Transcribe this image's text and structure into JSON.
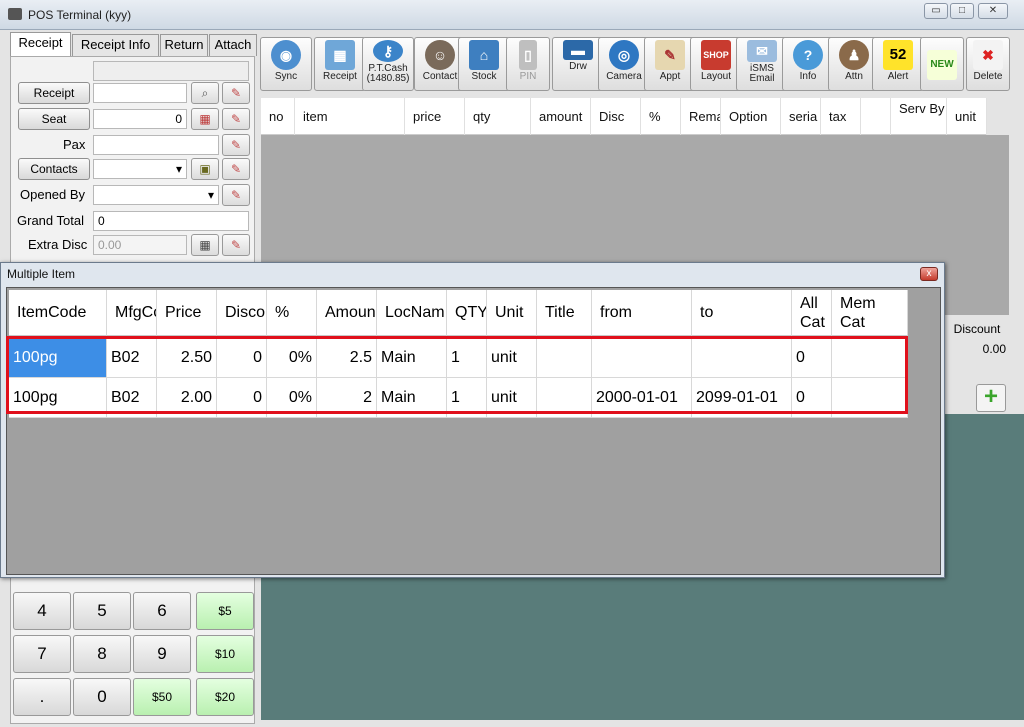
{
  "window": {
    "title": "POS Terminal (kyy)",
    "min": "▭",
    "restore": "□",
    "close": "✕"
  },
  "tabs": [
    "Receipt",
    "Receipt Info",
    "Return",
    "Attach"
  ],
  "left": {
    "receipt_btn": "Receipt",
    "seat_btn": "Seat",
    "seat_value": "0",
    "pax_label": "Pax",
    "contacts_btn": "Contacts",
    "opened_by_label": "Opened By",
    "grand_total_label": "Grand Total",
    "grand_total_value": "0",
    "extra_disc_label": "Extra Disc",
    "extra_disc_value": "0.00"
  },
  "keypad": {
    "keys": [
      "4",
      "5",
      "6",
      "7",
      "8",
      "9",
      ".",
      "0"
    ],
    "money": [
      "$5",
      "$10",
      "$50",
      "$20"
    ]
  },
  "toolbar": [
    {
      "label": "Sync",
      "icon": "sync-icon"
    },
    {
      "label": "Receipt",
      "icon": "receipt-icon"
    },
    {
      "label": "P.T.Cash\n(1480.85)",
      "icon": "key-icon"
    },
    {
      "label": "Contact",
      "icon": "contact-icon"
    },
    {
      "label": "Stock",
      "icon": "house-icon"
    },
    {
      "label": "PIN",
      "icon": "phone-icon"
    },
    {
      "label": "Drw",
      "icon": "drawer-icon"
    },
    {
      "label": "Camera",
      "icon": "camera-icon"
    },
    {
      "label": "Appt",
      "icon": "appointment-icon"
    },
    {
      "label": "Layout",
      "icon": "shop-icon"
    },
    {
      "label": "iSMS\nEmail",
      "icon": "email-icon"
    },
    {
      "label": "Info",
      "icon": "info-icon"
    },
    {
      "label": "Attn",
      "icon": "attendance-icon"
    },
    {
      "label": "Alert",
      "icon": "alert-icon",
      "badge": "52"
    },
    {
      "label": "NEW",
      "icon": "new-icon"
    },
    {
      "label": "Delete",
      "icon": "delete-icon"
    }
  ],
  "grid_headers": [
    "no",
    "item",
    "price",
    "qty",
    "amount",
    "Disc",
    "%",
    "Rema",
    "Option",
    "seria",
    "tax",
    "",
    "Serv By",
    "unit"
  ],
  "discount": {
    "label": "Discount",
    "value": "0.00"
  },
  "dialog": {
    "title": "Multiple Item",
    "close": "x",
    "headers": [
      "ItemCode",
      "MfgCo",
      "Price",
      "Disco",
      "%",
      "Amoun",
      "LocNam",
      "QTY",
      "Unit",
      "Title",
      "from",
      "to",
      "All\nCat",
      "Mem\nCat"
    ],
    "rows": [
      [
        "100pg",
        "B02",
        "2.50",
        "0",
        "0%",
        "2.5",
        "Main",
        "1",
        "unit",
        "",
        "",
        "",
        "0",
        ""
      ],
      [
        "100pg",
        "B02",
        "2.00",
        "0",
        "0%",
        "2",
        "Main",
        "1",
        "unit",
        "",
        "2000-01-01",
        "2099-01-01",
        "0",
        ""
      ]
    ]
  },
  "colors": {
    "selection": "#3d8ee6",
    "highlight_box": "#e0101c",
    "teal_panel": "#597c7a",
    "money_key": "#c6f3bd"
  }
}
